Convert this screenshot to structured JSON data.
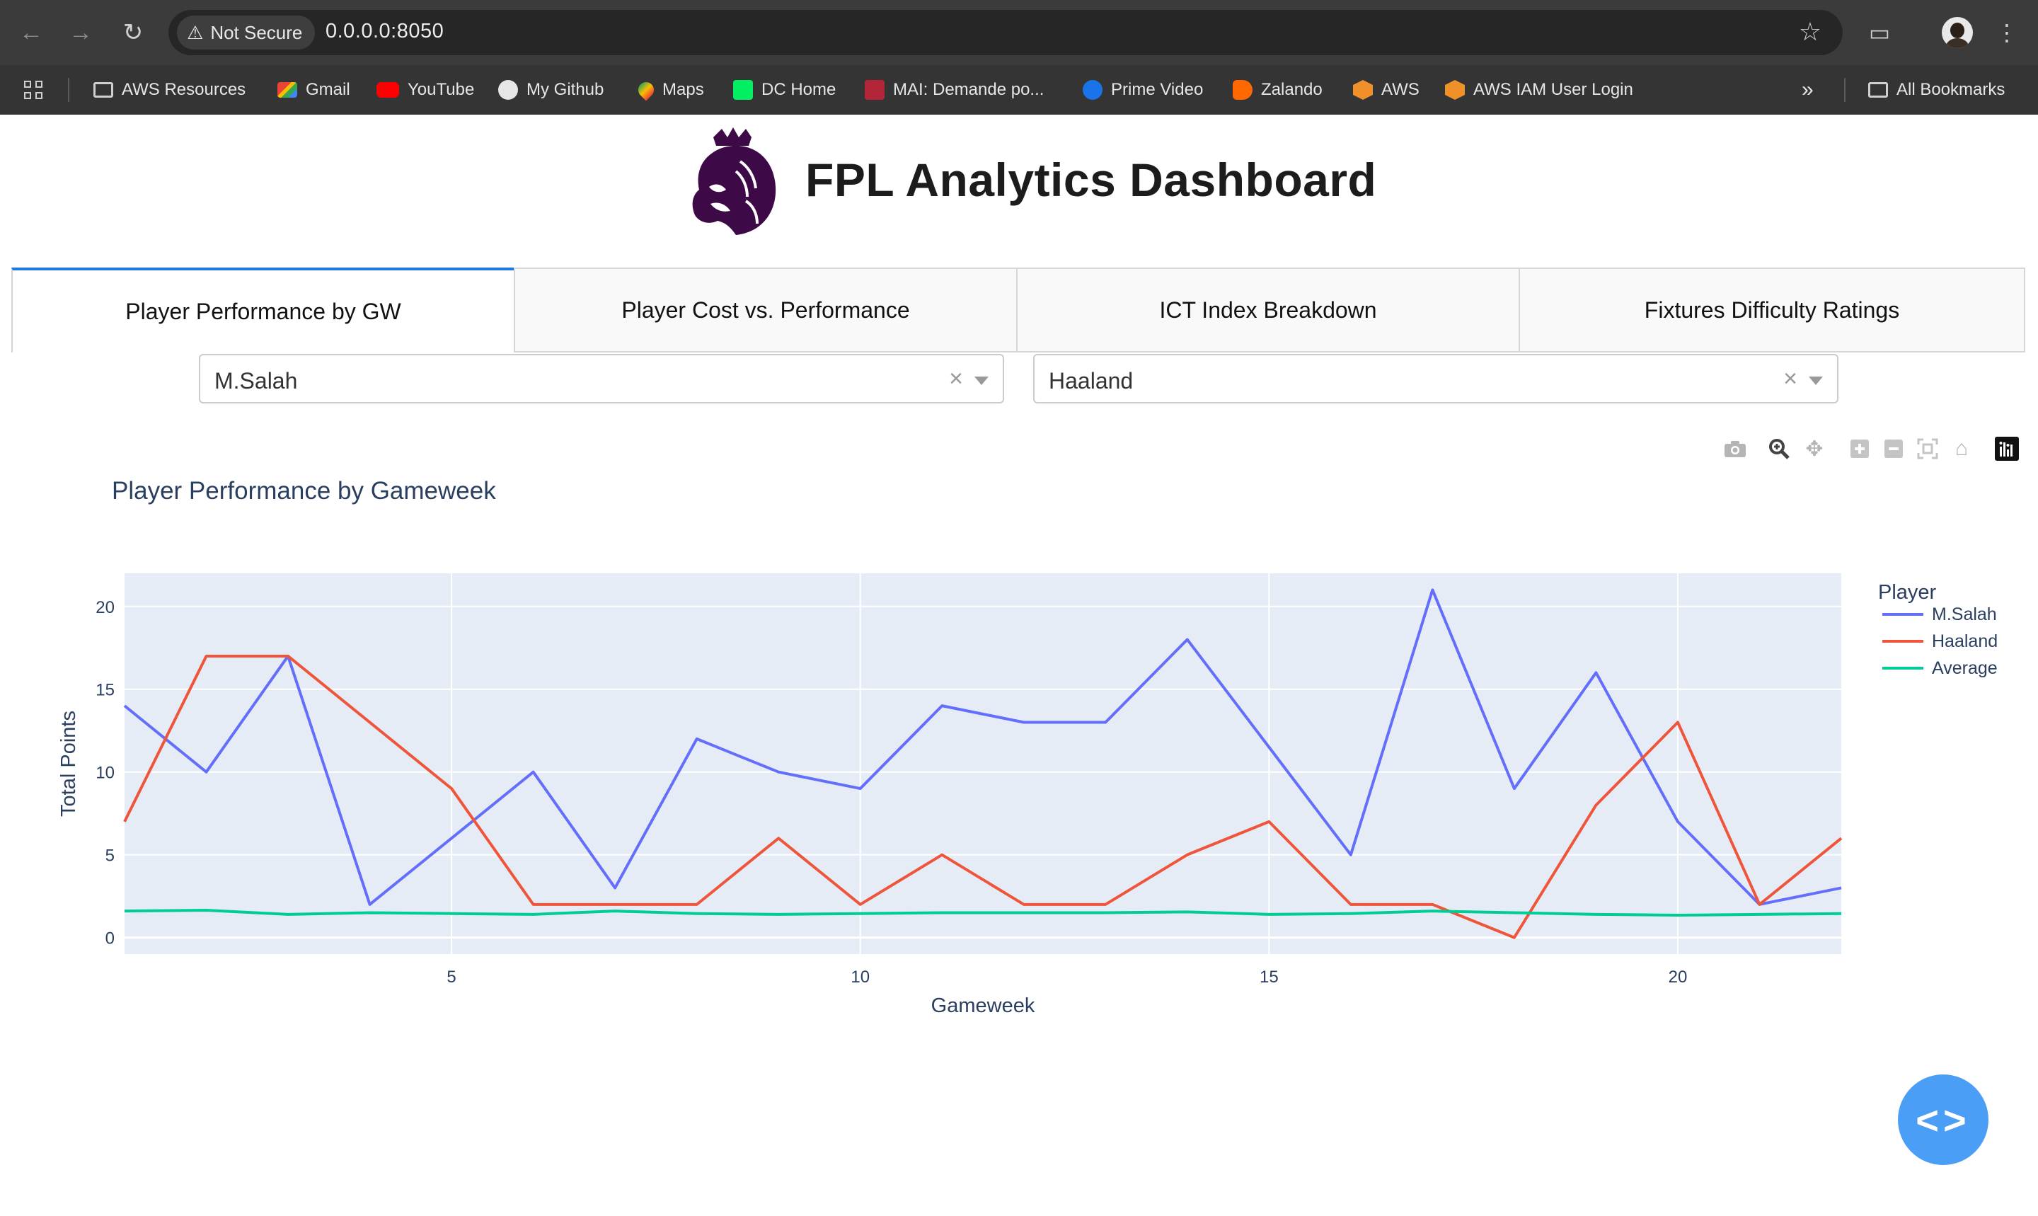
{
  "browser": {
    "security_label": "Not Secure",
    "url": "0.0.0.0:8050",
    "bookmarks": [
      {
        "label": "AWS Resources",
        "icon": "folder-icon"
      },
      {
        "label": "Gmail",
        "icon": "gmail-icon"
      },
      {
        "label": "YouTube",
        "icon": "youtube-icon"
      },
      {
        "label": "My Github",
        "icon": "github-icon"
      },
      {
        "label": "Maps",
        "icon": "maps-icon"
      },
      {
        "label": "DC Home",
        "icon": "dc-icon"
      },
      {
        "label": "MAI: Demande po...",
        "icon": "mai-icon"
      },
      {
        "label": "Prime Video",
        "icon": "prime-video-icon"
      },
      {
        "label": "Zalando",
        "icon": "zalando-icon"
      },
      {
        "label": "AWS",
        "icon": "aws-icon"
      },
      {
        "label": "AWS IAM User Login",
        "icon": "aws-icon"
      }
    ],
    "all_bookmarks_label": "All Bookmarks"
  },
  "header": {
    "title": "FPL Analytics Dashboard"
  },
  "tabs": [
    {
      "label": "Player Performance by GW",
      "active": true
    },
    {
      "label": "Player Cost vs. Performance",
      "active": false
    },
    {
      "label": "ICT Index Breakdown",
      "active": false
    },
    {
      "label": "Fixtures Difficulty Ratings",
      "active": false
    }
  ],
  "filters": {
    "player1": "M.Salah",
    "player2": "Haaland",
    "clear_symbol": "×"
  },
  "dev_button": {
    "label": "<>"
  },
  "colors": {
    "salah": "#636efa",
    "haaland": "#ef553b",
    "average": "#00cc96",
    "plot_bg": "#e5ecf6",
    "accent": "#1f77e4"
  },
  "chart_data": {
    "type": "line",
    "title": "Player Performance by Gameweek",
    "xlabel": "Gameweek",
    "ylabel": "Total Points",
    "xlim": [
      1,
      22
    ],
    "ylim": [
      -1,
      22
    ],
    "x_ticks": [
      5,
      10,
      15,
      20
    ],
    "y_ticks": [
      0,
      5,
      10,
      15,
      20
    ],
    "legend_title": "Player",
    "legend_position": "right",
    "grid": true,
    "x": [
      1,
      2,
      3,
      4,
      5,
      6,
      7,
      8,
      9,
      10,
      11,
      12,
      13,
      14,
      15,
      16,
      17,
      18,
      19,
      20,
      21,
      22
    ],
    "series": [
      {
        "name": "M.Salah",
        "values": [
          14,
          10,
          17,
          2,
          6,
          10,
          3,
          12,
          10,
          9,
          14,
          13,
          13,
          18,
          11.5,
          5,
          21,
          9,
          16,
          7,
          2,
          3
        ]
      },
      {
        "name": "Haaland",
        "values": [
          7,
          17,
          17,
          13,
          9,
          2,
          2,
          2,
          6,
          2,
          5,
          2,
          2,
          5,
          7,
          2,
          2,
          0,
          8,
          13,
          2,
          6
        ]
      },
      {
        "name": "Average",
        "values": [
          1.6,
          1.65,
          1.4,
          1.5,
          1.45,
          1.4,
          1.6,
          1.45,
          1.4,
          1.45,
          1.5,
          1.5,
          1.5,
          1.55,
          1.4,
          1.45,
          1.6,
          1.5,
          1.4,
          1.35,
          1.4,
          1.45
        ]
      }
    ]
  }
}
